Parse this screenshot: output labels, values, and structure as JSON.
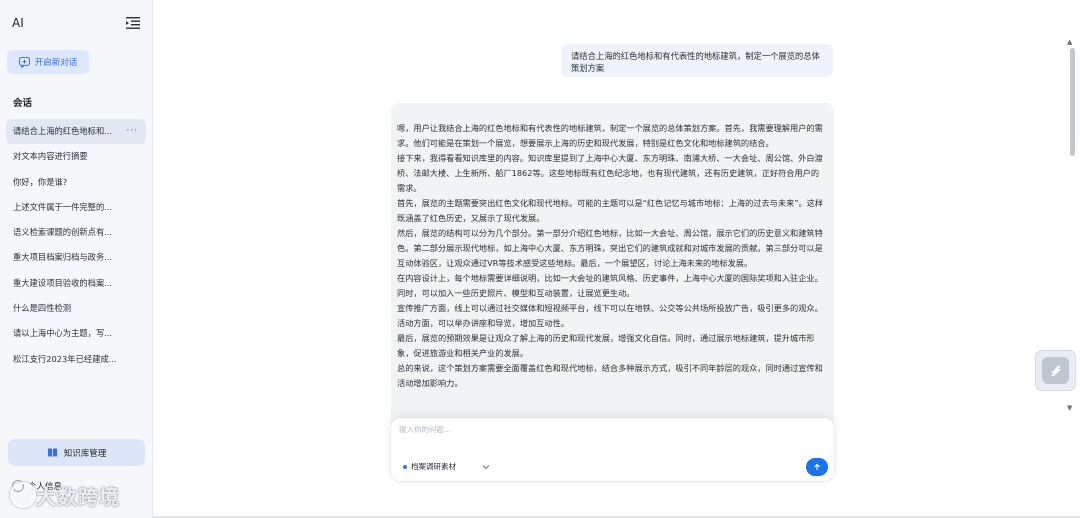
{
  "sidebar": {
    "brand": "AI",
    "new_chat_label": "开启新对话",
    "section_title": "会话",
    "conversations": [
      "请结合上海的红色地标和...",
      "对文本内容进行摘要",
      "你好，你是谁?",
      "上述文件属于一件完整的...",
      "语义检索课题的创新点有...",
      "重大项目档案归档与政务...",
      "重大建设项目验收的档案...",
      "什么是四性检测",
      "请以上海中心为主题，写...",
      "松江支行2023年已经建成..."
    ],
    "active_more": "···",
    "kb_button_label": "知识库管理",
    "profile_label": "个人信息",
    "watermark_text": "大数跨境"
  },
  "chat": {
    "user_message": "请结合上海的红色地标和有代表性的地标建筑，制定一个展览的总体策划方案",
    "ai_paragraphs": [
      "嗯，用户让我结合上海的红色地标和有代表性的地标建筑，制定一个展览的总体策划方案。首先，我需要理解用户的需求。他们可能是在策划一个展览，想要展示上海的历史和现代发展，特别是红色文化和地标建筑的结合。",
      "接下来，我得看看知识库里的内容。知识库里提到了上海中心大厦、东方明珠、南浦大桥、一大会址、周公馆、外白渡桥、法邮大楼、上生新所、船厂1862等。这些地标既有红色纪念地，也有现代建筑，还有历史建筑，正好符合用户的需求。",
      "首先，展览的主题需要突出红色文化和现代地标。可能的主题可以是“红色记忆与城市地标：上海的过去与未来”。这样既涵盖了红色历史，又展示了现代发展。",
      "然后，展览的结构可以分为几个部分。第一部分介绍红色地标，比如一大会址、周公馆，展示它们的历史意义和建筑特色。第二部分展示现代地标，如上海中心大厦、东方明珠，突出它们的建筑成就和对城市发展的贡献。第三部分可以是互动体验区，让观众通过VR等技术感受这些地标。最后，一个展望区，讨论上海未来的地标发展。",
      "在内容设计上，每个地标需要详细说明，比如一大会址的建筑风格、历史事件，上海中心大厦的国际奖项和入驻企业。同时，可以加入一些历史照片、模型和互动装置，让展览更生动。",
      "宣传推广方面，线上可以通过社交媒体和短视频平台，线下可以在地铁、公交等公共场所投放广告，吸引更多的观众。活动方面，可以举办讲座和导览，增加互动性。",
      "最后，展览的预期效果是让观众了解上海的历史和现代发展，增强文化自信。同时，通过展示地标建筑，提升城市形象，促进旅游业和相关产业的发展。",
      "总的来说，这个策划方案需要全面覆盖红色和现代地标，结合多种展示方式，吸引不同年龄层的观众，同时通过宣传和活动增加影响力。"
    ]
  },
  "composer": {
    "placeholder": "输入你的问题...",
    "value": "",
    "kb_selector_label": "档案调研素材"
  },
  "colors": {
    "accent": "#1a73e8",
    "sidebar_bg": "#f5f7fb",
    "ai_bubble_bg": "#f2f3f5",
    "user_bubble_bg": "#eef3fc"
  },
  "icons": {
    "collapse": "menu-collapse-icon",
    "new_chat": "chat-plus-icon",
    "knowledge_base": "book-icon",
    "send": "arrow-up-icon",
    "selector": "chevron-down-icon",
    "floating": "assistant-widget-icon"
  }
}
